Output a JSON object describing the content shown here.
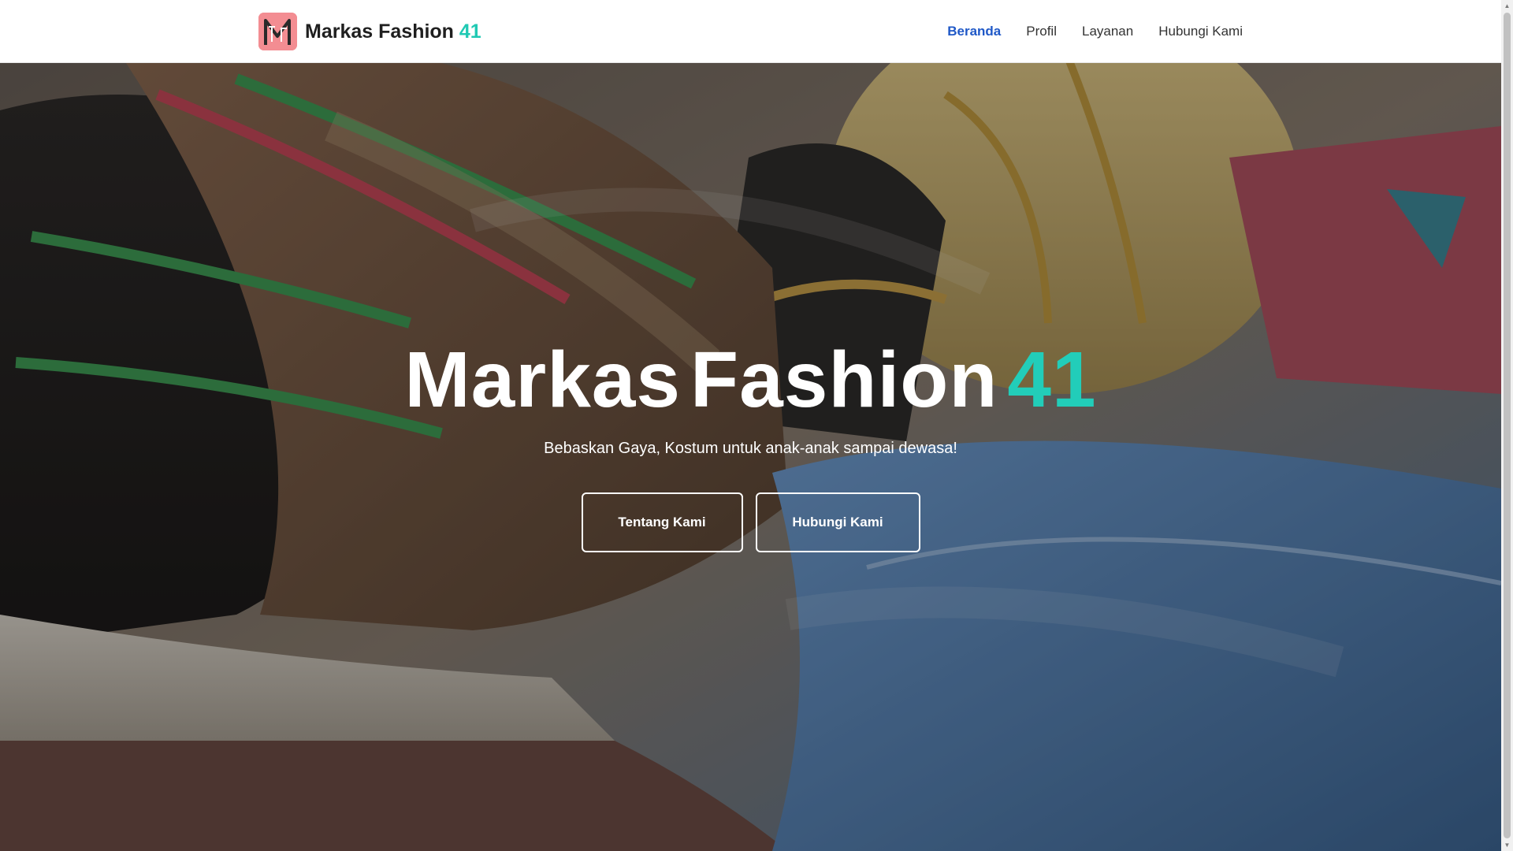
{
  "brand": {
    "name": "Markas Fashion",
    "accent": "41",
    "logo_icon": "mf-monogram-logo"
  },
  "nav": {
    "items": [
      {
        "label": "Beranda",
        "active": true
      },
      {
        "label": "Profil",
        "active": false
      },
      {
        "label": "Layanan",
        "active": false
      },
      {
        "label": "Hubungi Kami",
        "active": false
      }
    ]
  },
  "hero": {
    "title_word1": "Markas",
    "title_word2": "Fashion",
    "title_accent": "41",
    "subtitle": "Bebaskan Gaya, Kostum untuk anak-anak sampai dewasa!",
    "buttons": {
      "about": "Tentang Kami",
      "contact": "Hubungi Kami"
    },
    "background": "photo-of-traditional-caps-and-costumes"
  },
  "colors": {
    "accent_teal": "#20c9b3",
    "nav_active_blue": "#1f58c7",
    "logo_pink": "#f38d92",
    "text_dark": "#1f1f1f"
  }
}
